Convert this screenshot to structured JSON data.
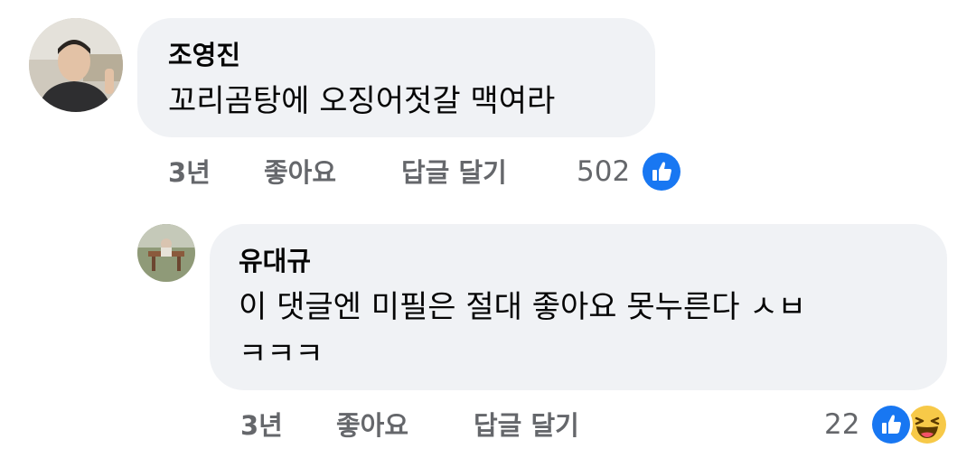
{
  "comments": [
    {
      "author": "조영진",
      "text": "꼬리곰탕에 오징어젓갈 맥여라",
      "time": "3년",
      "like_label": "좋아요",
      "reply_label": "답글 달기",
      "reaction_count": "502",
      "reactions": [
        "like-icon"
      ]
    },
    {
      "author": "유대규",
      "text_line1": "이 댓글엔 미필은 절대 좋아요 못누른다 ㅅㅂ",
      "text_line2": "ㅋㅋㅋ",
      "time": "3년",
      "like_label": "좋아요",
      "reply_label": "답글 달기",
      "reaction_count": "22",
      "reactions": [
        "like-icon",
        "haha-icon"
      ]
    }
  ],
  "colors": {
    "bubble": "#f0f2f5",
    "action_text": "#65676b",
    "like_blue": "#1877f2",
    "haha_yellow": "#f7c948"
  }
}
